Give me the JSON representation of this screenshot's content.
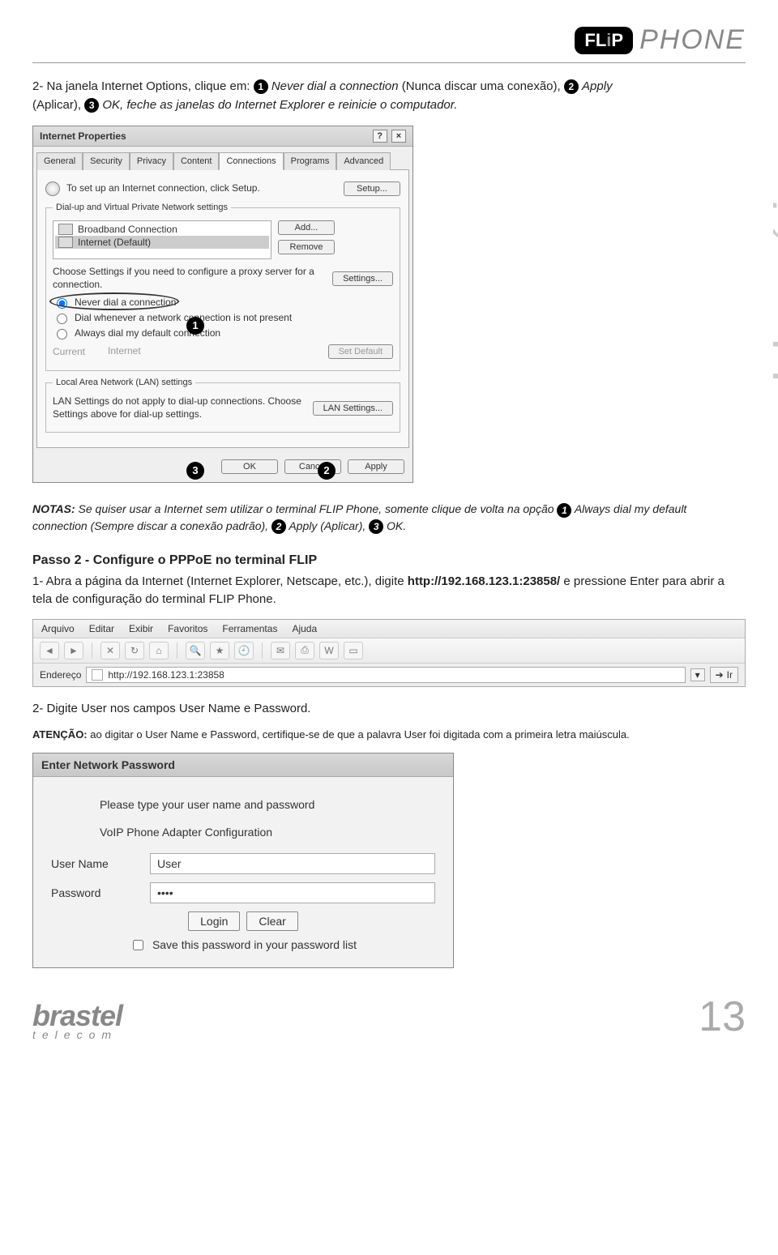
{
  "header": {
    "logo_flip": "FLiP",
    "logo_phone": "PHONE"
  },
  "side_label": "manual do usuário",
  "intro": {
    "prefix": "2- Na janela Internet Options, clique em:",
    "p1": "Never dial a connection",
    "p1_trans": "(Nunca discar uma conexão),",
    "p2": "Apply",
    "p2_trans": "(Aplicar),",
    "p3": "OK, feche as janelas do Internet Explorer e reinicie o computador."
  },
  "dialog": {
    "title": "Internet Properties",
    "tabs": [
      "General",
      "Security",
      "Privacy",
      "Content",
      "Connections",
      "Programs",
      "Advanced"
    ],
    "setup_text": "To set up an Internet connection, click Setup.",
    "setup_btn": "Setup...",
    "dial_group": "Dial-up and Virtual Private Network settings",
    "conn1": "Broadband Connection",
    "conn2": "Internet (Default)",
    "add_btn": "Add...",
    "remove_btn": "Remove",
    "choose_text": "Choose Settings if you need to configure a proxy server for a connection.",
    "settings_btn": "Settings...",
    "radio1": "Never dial a connection",
    "radio2": "Dial whenever a network connection is not present",
    "radio3": "Always dial my default connection",
    "current_label": "Current",
    "current_value": "Internet",
    "setdefault_btn": "Set Default",
    "lan_group": "Local Area Network (LAN) settings",
    "lan_text": "LAN Settings do not apply to dial-up connections. Choose Settings above for dial-up settings.",
    "lan_btn": "LAN Settings...",
    "ok_btn": "OK",
    "cancel_btn": "Cancel",
    "apply_btn": "Apply"
  },
  "notas": {
    "prefix": "NOTAS:",
    "body1": "Se quiser usar a Internet sem utilizar o terminal FLIP Phone, somente clique de volta na opção",
    "r1": "Always dial my default connection",
    "body2": "(Sempre discar a conexão padrão),",
    "r2": "Apply",
    "body3": "(Aplicar),",
    "r3": "OK."
  },
  "step2": {
    "title": "Passo 2 - Configure o PPPoE no terminal FLIP",
    "body_a": "1- Abra a página da Internet (Internet Explorer, Netscape, etc.), digite",
    "url": "http://192.168.123.1:23858/",
    "body_b": "e pressione Enter para abrir a tela de configuração do terminal FLIP Phone."
  },
  "iebar": {
    "menus": [
      "Arquivo",
      "Editar",
      "Exibir",
      "Favoritos",
      "Ferramentas",
      "Ajuda"
    ],
    "addr_label": "Endereço",
    "url": "http://192.168.123.1:23858",
    "go": "Ir"
  },
  "step2b": {
    "line": "2- Digite User nos campos User Name e Password.",
    "att_label": "ATENÇÃO:",
    "att_body": "ao digitar o User Name e Password, certifique-se de que a palavra User foi digitada com a primeira letra maiúscula."
  },
  "pwdialog": {
    "title": "Enter Network Password",
    "line1": "Please type your user name and password",
    "line2": "VoIP Phone Adapter Configuration",
    "uname_label": "User Name",
    "uname_value": "User",
    "pwd_label": "Password",
    "pwd_value": "••••",
    "login_btn": "Login",
    "clear_btn": "Clear",
    "save_label": "Save this password in your password list"
  },
  "footer": {
    "brand": "brastel",
    "brand_sub": "telecom",
    "page": "13"
  }
}
